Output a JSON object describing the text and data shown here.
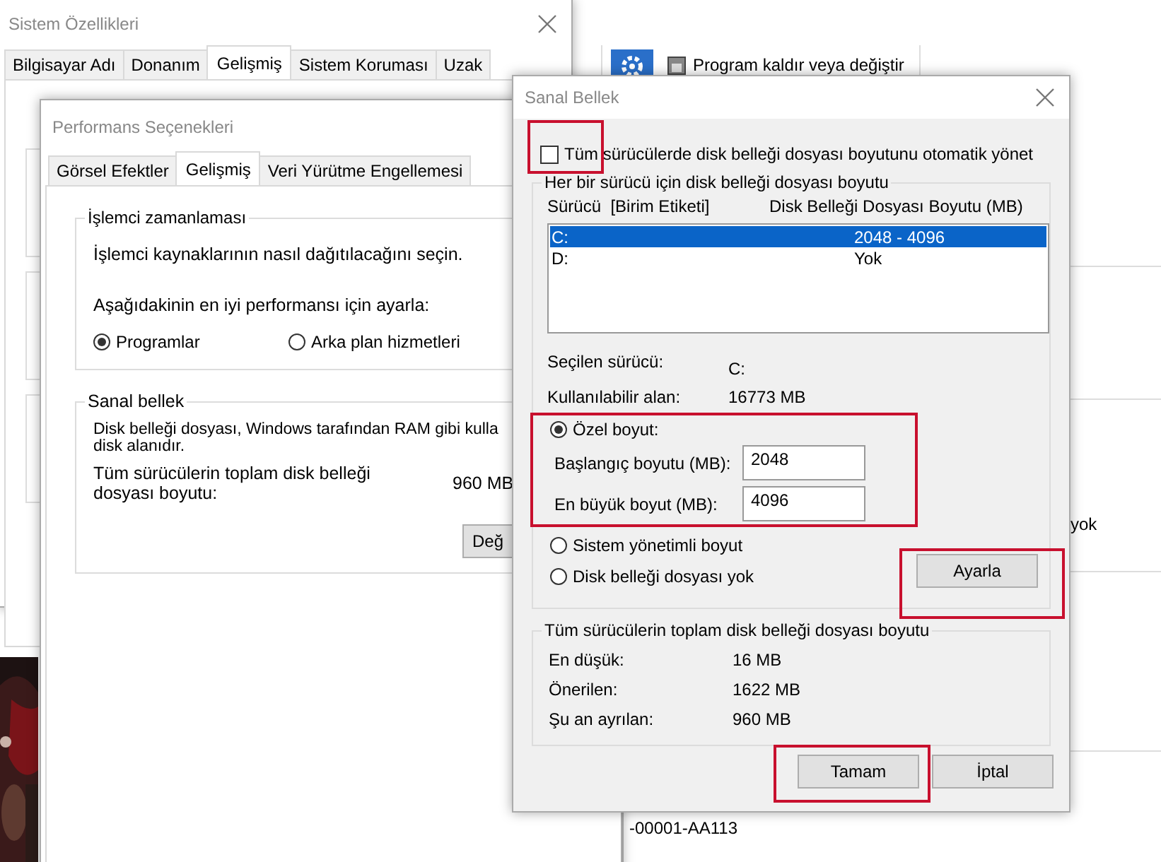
{
  "background_window": {
    "toolbar_items": [
      {
        "label": "Program kaldır veya değiştir"
      }
    ],
    "fragments": [
      {
        "text": "yok"
      },
      {
        "text": "-00001-AA113"
      }
    ]
  },
  "system_properties": {
    "title": "Sistem Özellikleri",
    "tabs": [
      {
        "label": "Bilgisayar Adı",
        "selected": false
      },
      {
        "label": "Donanım",
        "selected": false
      },
      {
        "label": "Gelişmiş",
        "selected": true
      },
      {
        "label": "Sistem Koruması",
        "selected": false
      },
      {
        "label": "Uzak",
        "selected": false
      }
    ]
  },
  "performance_options": {
    "title": "Performans Seçenekleri",
    "tabs": [
      {
        "label": "Görsel Efektler",
        "selected": false
      },
      {
        "label": "Gelişmiş",
        "selected": true
      },
      {
        "label": "Veri Yürütme Engellemesi",
        "selected": false
      }
    ],
    "processor_group": {
      "title": "İşlemci zamanlaması",
      "description": "İşlemci kaynaklarının nasıl dağıtılacağını seçin.",
      "prompt": "Aşağıdakinin en iyi performansı için ayarla:",
      "options": [
        {
          "label": "Programlar",
          "selected": true
        },
        {
          "label": "Arka plan hizmetleri",
          "selected": false
        }
      ]
    },
    "virtual_memory_group": {
      "title": "Sanal bellek",
      "description_lines": [
        "Disk belleği dosyası, Windows tarafından RAM gibi kulla",
        "disk alanıdır."
      ],
      "total_label": "Tüm sürücülerin toplam disk belleği dosyası boyutu:",
      "total_value": "960 MB",
      "button": "Değ"
    }
  },
  "virtual_memory_dialog": {
    "title": "Sanal Bellek",
    "auto_manage": {
      "label": "Tüm sürücülerde disk belleği dosyası boyutunu otomatik yönet",
      "checked": false
    },
    "drives_group": {
      "title": "Her bir sürücü için disk belleği dosyası boyutu",
      "columns": [
        "Sürücü  [Birim Etiketi]",
        "Disk Belleği Dosyası Boyutu (MB)"
      ],
      "rows": [
        {
          "drive": "C:",
          "size": "2048 - 4096",
          "selected": true
        },
        {
          "drive": "D:",
          "size": "Yok",
          "selected": false
        }
      ],
      "info": [
        {
          "label": "Seçilen sürücü:",
          "value": "C:"
        },
        {
          "label": "Kullanılabilir alan:",
          "value": "16773 MB"
        }
      ],
      "size_options": [
        {
          "label": "Özel boyut:",
          "selected": true
        },
        {
          "label": "Sistem yönetimli boyut",
          "selected": false
        },
        {
          "label": "Disk belleği dosyası yok",
          "selected": false
        }
      ],
      "fields": [
        {
          "label": "Başlangıç boyutu (MB):",
          "value": "2048"
        },
        {
          "label": "En büyük boyut (MB):",
          "value": "4096"
        }
      ],
      "set_button": "Ayarla"
    },
    "totals_group": {
      "title": "Tüm sürücülerin toplam disk belleği dosyası boyutu",
      "rows": [
        {
          "label": "En düşük:",
          "value": "16 MB"
        },
        {
          "label": "Önerilen:",
          "value": "1622 MB"
        },
        {
          "label": "Şu an ayrılan:",
          "value": "960 MB"
        }
      ]
    },
    "buttons": [
      {
        "label": "Tamam"
      },
      {
        "label": "İptal"
      }
    ]
  }
}
